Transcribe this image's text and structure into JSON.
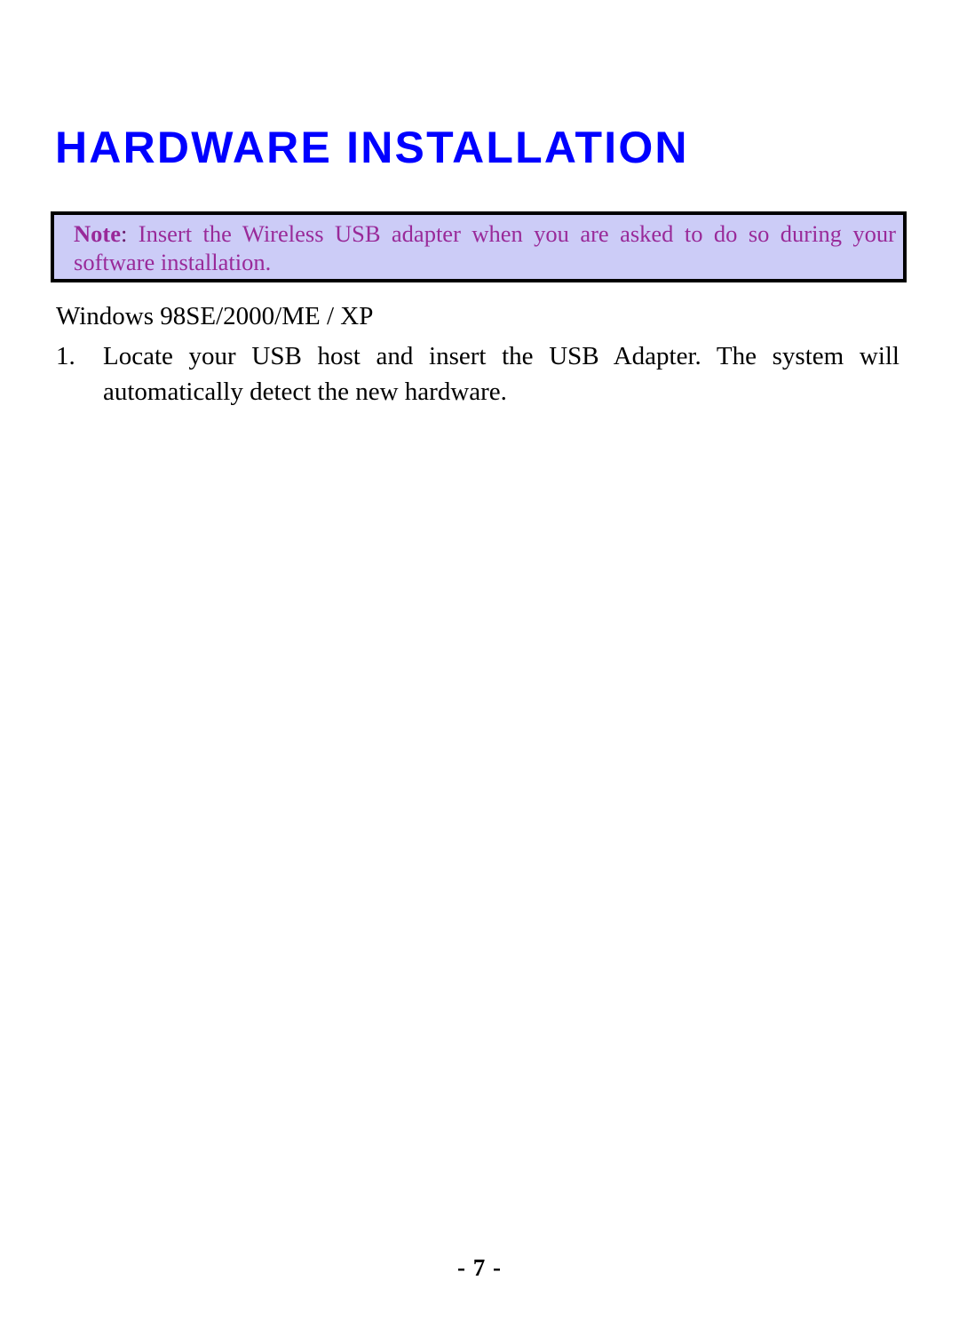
{
  "document": {
    "title": "HARDWARE INSTALLATION",
    "title_color": "#0000ff"
  },
  "note": {
    "label": "Note",
    "colon": ":",
    "body": " Insert the Wireless USB adapter when you are asked to do so during your software installation.",
    "background_color": "#ccccf7",
    "text_color": "#992a99",
    "border_color": "#000000"
  },
  "section": {
    "os_heading": "Windows 98SE/2000/ME / XP"
  },
  "steps": [
    {
      "number": "1.",
      "text": "Locate your USB host and insert the USB Adapter. The system will automatically detect the new hardware."
    }
  ],
  "footer": {
    "page_marker": "- 7 -"
  }
}
